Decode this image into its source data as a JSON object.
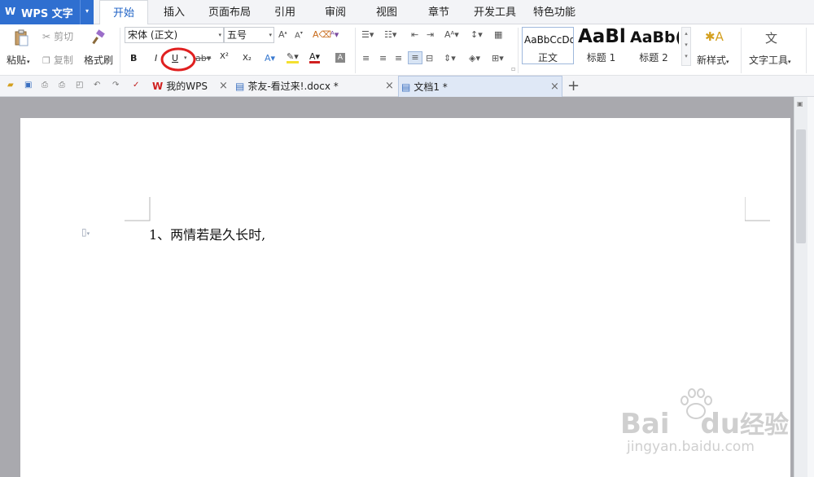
{
  "app": {
    "logo_glyph": "W",
    "name": "WPS 文字",
    "menu_dropdown": "▾"
  },
  "menu": {
    "tabs": [
      "开始",
      "插入",
      "页面布局",
      "引用",
      "审阅",
      "视图",
      "章节",
      "开发工具",
      "特色功能"
    ],
    "active": "开始"
  },
  "ribbon": {
    "paste": "粘贴",
    "cut": "剪切",
    "copy": "复制",
    "format_painter": "格式刷",
    "font_name": "宋体 (正文)",
    "font_size": "五号",
    "bold": "B",
    "italic": "I",
    "underline": "U",
    "superscript": "X²",
    "subscript": "X₂",
    "styles": [
      {
        "sample": "AaBbCcDd",
        "label": "正文"
      },
      {
        "sample": "AaBl",
        "label": "标题 1"
      },
      {
        "sample": "AaBb(",
        "label": "标题 2"
      }
    ],
    "new_style": "新样式",
    "text_tools": "文字工具",
    "dropdown_arrow": "▾",
    "scroll_up": "▴",
    "scroll_down": "▾",
    "launcher_glyph": "▫"
  },
  "doc_tabs": [
    {
      "title": "我的WPS",
      "close": "×"
    },
    {
      "title": "茶友-看过来!.docx *",
      "close": "×"
    },
    {
      "title": "文档1 *",
      "close": "×"
    }
  ],
  "new_tab": "+",
  "document": {
    "line1": "1、两情若是久长时,"
  },
  "highlight": {
    "color": "#e02020",
    "target": "underline-button"
  },
  "watermark": {
    "brand": "Bai",
    "brand_du": "du",
    "brand_cn": "经验",
    "url": "jingyan.baidu.com"
  },
  "colors": {
    "accent": "#2f6fd0",
    "active_tab_text": "#1e62c5"
  }
}
